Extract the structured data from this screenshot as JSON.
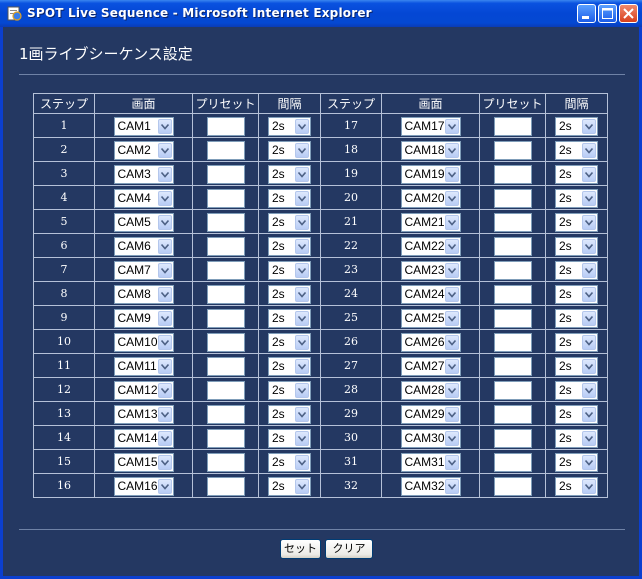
{
  "window": {
    "title": "SPOT Live Sequence - Microsoft Internet Explorer",
    "icon": "ie-page-icon",
    "controls": [
      "minimize-icon",
      "maximize-icon",
      "close-icon"
    ]
  },
  "page": {
    "title": "1画ライブシーケンス設定"
  },
  "table": {
    "headers": [
      "ステップ",
      "画面",
      "プリセット",
      "間隔",
      "ステップ",
      "画面",
      "プリセット",
      "間隔"
    ],
    "left_rows": [
      {
        "step": "1",
        "camera": "CAM1",
        "preset": "",
        "interval": "2s"
      },
      {
        "step": "2",
        "camera": "CAM2",
        "preset": "",
        "interval": "2s"
      },
      {
        "step": "3",
        "camera": "CAM3",
        "preset": "",
        "interval": "2s"
      },
      {
        "step": "4",
        "camera": "CAM4",
        "preset": "",
        "interval": "2s"
      },
      {
        "step": "5",
        "camera": "CAM5",
        "preset": "",
        "interval": "2s"
      },
      {
        "step": "6",
        "camera": "CAM6",
        "preset": "",
        "interval": "2s"
      },
      {
        "step": "7",
        "camera": "CAM7",
        "preset": "",
        "interval": "2s"
      },
      {
        "step": "8",
        "camera": "CAM8",
        "preset": "",
        "interval": "2s"
      },
      {
        "step": "9",
        "camera": "CAM9",
        "preset": "",
        "interval": "2s"
      },
      {
        "step": "10",
        "camera": "CAM10",
        "preset": "",
        "interval": "2s"
      },
      {
        "step": "11",
        "camera": "CAM11",
        "preset": "",
        "interval": "2s"
      },
      {
        "step": "12",
        "camera": "CAM12",
        "preset": "",
        "interval": "2s"
      },
      {
        "step": "13",
        "camera": "CAM13",
        "preset": "",
        "interval": "2s"
      },
      {
        "step": "14",
        "camera": "CAM14",
        "preset": "",
        "interval": "2s"
      },
      {
        "step": "15",
        "camera": "CAM15",
        "preset": "",
        "interval": "2s"
      },
      {
        "step": "16",
        "camera": "CAM16",
        "preset": "",
        "interval": "2s"
      }
    ],
    "right_rows": [
      {
        "step": "17",
        "camera": "CAM17",
        "preset": "",
        "interval": "2s"
      },
      {
        "step": "18",
        "camera": "CAM18",
        "preset": "",
        "interval": "2s"
      },
      {
        "step": "19",
        "camera": "CAM19",
        "preset": "",
        "interval": "2s"
      },
      {
        "step": "20",
        "camera": "CAM20",
        "preset": "",
        "interval": "2s"
      },
      {
        "step": "21",
        "camera": "CAM21",
        "preset": "",
        "interval": "2s"
      },
      {
        "step": "22",
        "camera": "CAM22",
        "preset": "",
        "interval": "2s"
      },
      {
        "step": "23",
        "camera": "CAM23",
        "preset": "",
        "interval": "2s"
      },
      {
        "step": "24",
        "camera": "CAM24",
        "preset": "",
        "interval": "2s"
      },
      {
        "step": "25",
        "camera": "CAM25",
        "preset": "",
        "interval": "2s"
      },
      {
        "step": "26",
        "camera": "CAM26",
        "preset": "",
        "interval": "2s"
      },
      {
        "step": "27",
        "camera": "CAM27",
        "preset": "",
        "interval": "2s"
      },
      {
        "step": "28",
        "camera": "CAM28",
        "preset": "",
        "interval": "2s"
      },
      {
        "step": "29",
        "camera": "CAM29",
        "preset": "",
        "interval": "2s"
      },
      {
        "step": "30",
        "camera": "CAM30",
        "preset": "",
        "interval": "2s"
      },
      {
        "step": "31",
        "camera": "CAM31",
        "preset": "",
        "interval": "2s"
      },
      {
        "step": "32",
        "camera": "CAM32",
        "preset": "",
        "interval": "2s"
      }
    ]
  },
  "buttons": {
    "set_label": "セット",
    "clear_label": "クリア"
  },
  "colors": {
    "background": "#243862",
    "titlebar": "#0447d4",
    "grid_line": "#b5c1d8",
    "close_button": "#d8401c"
  }
}
